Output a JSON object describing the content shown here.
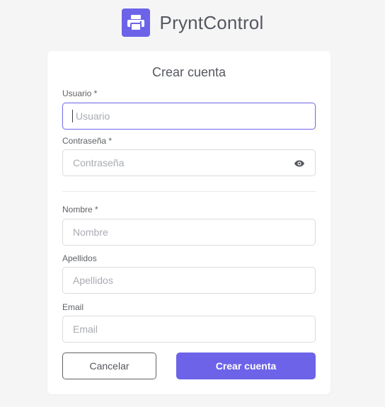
{
  "brand": {
    "name": "PryntControl",
    "logo_icon": "printer-icon",
    "accent_color": "#6c63e8"
  },
  "form": {
    "title": "Crear cuenta",
    "fields": {
      "usuario": {
        "label": "Usuario *",
        "placeholder": "Usuario",
        "value": ""
      },
      "contrasena": {
        "label": "Contraseña *",
        "placeholder": "Contraseña",
        "value": "",
        "toggle_icon": "eye-icon"
      },
      "nombre": {
        "label": "Nombre *",
        "placeholder": "Nombre",
        "value": ""
      },
      "apellidos": {
        "label": "Apellidos",
        "placeholder": "Apellidos",
        "value": ""
      },
      "email": {
        "label": "Email",
        "placeholder": "Email",
        "value": ""
      }
    },
    "buttons": {
      "cancel": "Cancelar",
      "submit": "Crear cuenta"
    }
  }
}
